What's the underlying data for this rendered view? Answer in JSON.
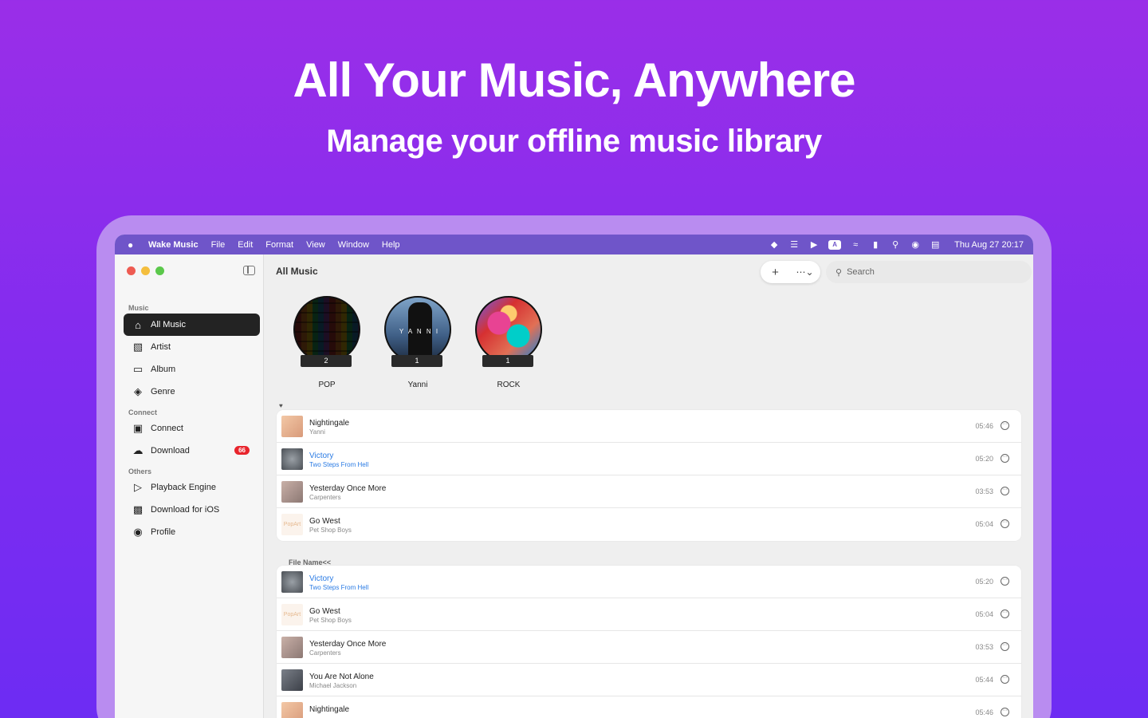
{
  "hero": {
    "title": "All Your Music, Anywhere",
    "subtitle": "Manage your offline music library"
  },
  "menubar": {
    "apple_icon": "apple-logo-icon",
    "app_name": "Wake Music",
    "menus": [
      "File",
      "Edit",
      "Format",
      "View",
      "Window",
      "Help"
    ],
    "status_icons": [
      "cat-icon",
      "fork-knife-icon",
      "play-circle-icon",
      "keyboard-input-icon",
      "wifi-icon",
      "battery-icon",
      "spotlight-search-icon",
      "siri-icon",
      "control-center-icon"
    ],
    "input_label": "A",
    "clock": "Thu Aug 27  20:17"
  },
  "sidebar": {
    "sections": [
      {
        "label": "Music"
      },
      {
        "label": "Connect"
      },
      {
        "label": "Others"
      }
    ],
    "items": [
      {
        "label": "All Music",
        "icon": "house-icon",
        "active": true
      },
      {
        "label": "Artist",
        "icon": "person-icon"
      },
      {
        "label": "Album",
        "icon": "stack-icon"
      },
      {
        "label": "Genre",
        "icon": "layers-icon"
      },
      {
        "label": "Connect",
        "icon": "car-icon"
      },
      {
        "label": "Download",
        "icon": "cloud-download-icon",
        "badge": "66"
      },
      {
        "label": "Playback Engine",
        "icon": "play-rect-icon"
      },
      {
        "label": "Download for iOS",
        "icon": "laptop-phone-icon"
      },
      {
        "label": "Profile",
        "icon": "person-circle-icon"
      }
    ]
  },
  "main": {
    "title": "All Music",
    "search_placeholder": "Search",
    "genres": [
      {
        "name": "POP",
        "count": "2"
      },
      {
        "name": "Yanni",
        "count": "1"
      },
      {
        "name": "ROCK",
        "count": "1"
      }
    ],
    "yanni_art_text": "Y A N N I",
    "pop_art_text": "PopArt",
    "favorites": [
      {
        "title": "Nightingale",
        "artist": "Yanni",
        "duration": "05:46"
      },
      {
        "title": "Victory",
        "artist": "Two Steps From Hell",
        "duration": "05:20",
        "highlight": true
      },
      {
        "title": "Yesterday Once More",
        "artist": "Carpenters",
        "duration": "03:53"
      },
      {
        "title": "Go West",
        "artist": "Pet Shop Boys",
        "duration": "05:04"
      }
    ],
    "group_label": "File Name<<",
    "files": [
      {
        "title": "Victory",
        "artist": "Two Steps From Hell",
        "duration": "05:20",
        "highlight": true
      },
      {
        "title": "Go West",
        "artist": "Pet Shop Boys",
        "duration": "05:04"
      },
      {
        "title": "Yesterday Once More",
        "artist": "Carpenters",
        "duration": "03:53"
      },
      {
        "title": "You Are Not Alone",
        "artist": "Michael Jackson",
        "duration": "05:44"
      },
      {
        "title": "Nightingale",
        "artist": "",
        "duration": "05:46"
      }
    ]
  },
  "colors": {
    "accent_link": "#2a7be4",
    "badge": "#e8242c",
    "active_item": "#232323",
    "menubar": "#6f55c9"
  }
}
